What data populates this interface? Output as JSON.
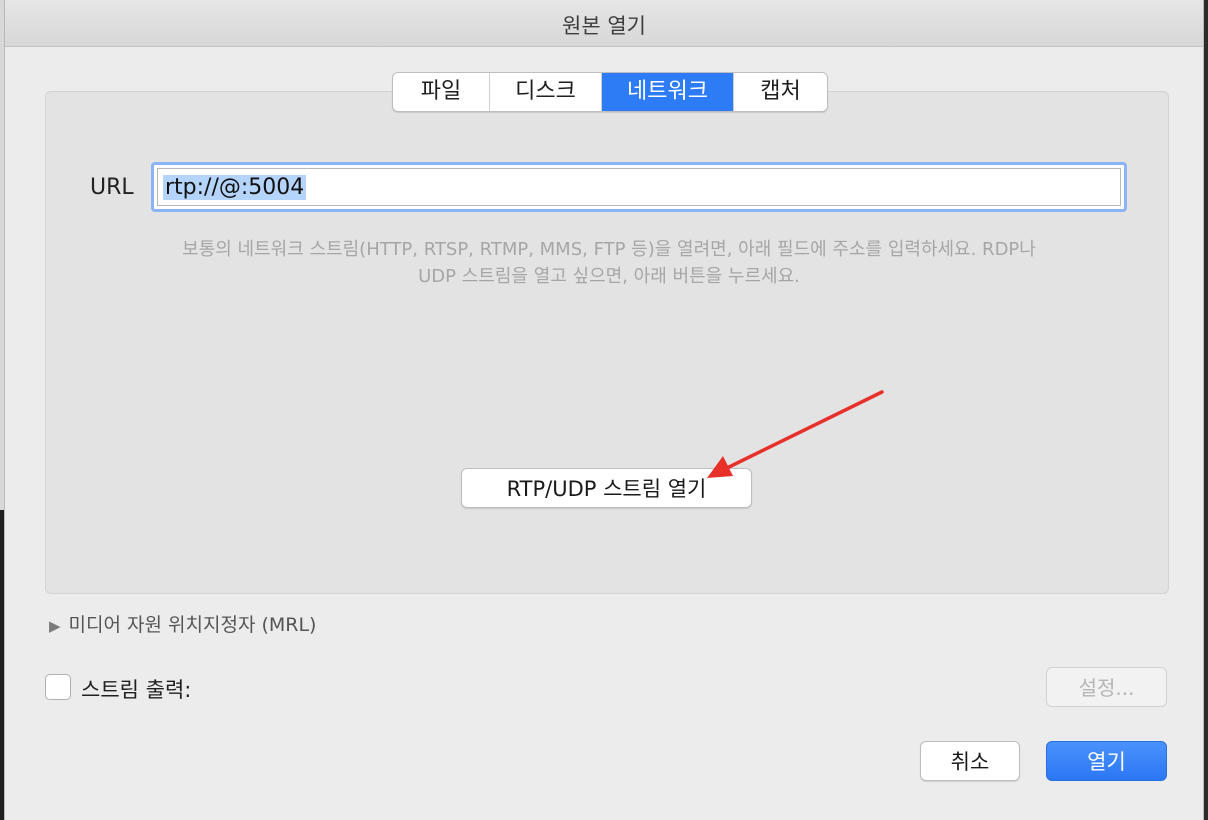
{
  "window": {
    "title": "원본 열기"
  },
  "tabs": [
    {
      "label": "파일"
    },
    {
      "label": "디스크"
    },
    {
      "label": "네트워크"
    },
    {
      "label": "캡처"
    }
  ],
  "active_tab": "네트워크",
  "network": {
    "url_label": "URL",
    "url_value": "rtp://@:5004",
    "help_line1": "보통의 네트워크 스트림(HTTP, RTSP, RTMP, MMS, FTP 등)을 열려면, 아래 필드에 주소를 입력하세요. RDP나",
    "help_line2": "UDP 스트림을 열고 싶으면, 아래 버튼을 누르세요.",
    "rtp_button": "RTP/UDP 스트림 열기"
  },
  "mrl": {
    "label": "미디어 자원 위치지정자 (MRL)"
  },
  "stream_output": {
    "label": "스트림 출력:",
    "checked": false,
    "settings_button": "설정..."
  },
  "actions": {
    "cancel": "취소",
    "open": "열기"
  },
  "colors": {
    "accent": "#2d7bf5",
    "annotation_arrow": "#e8302a"
  }
}
